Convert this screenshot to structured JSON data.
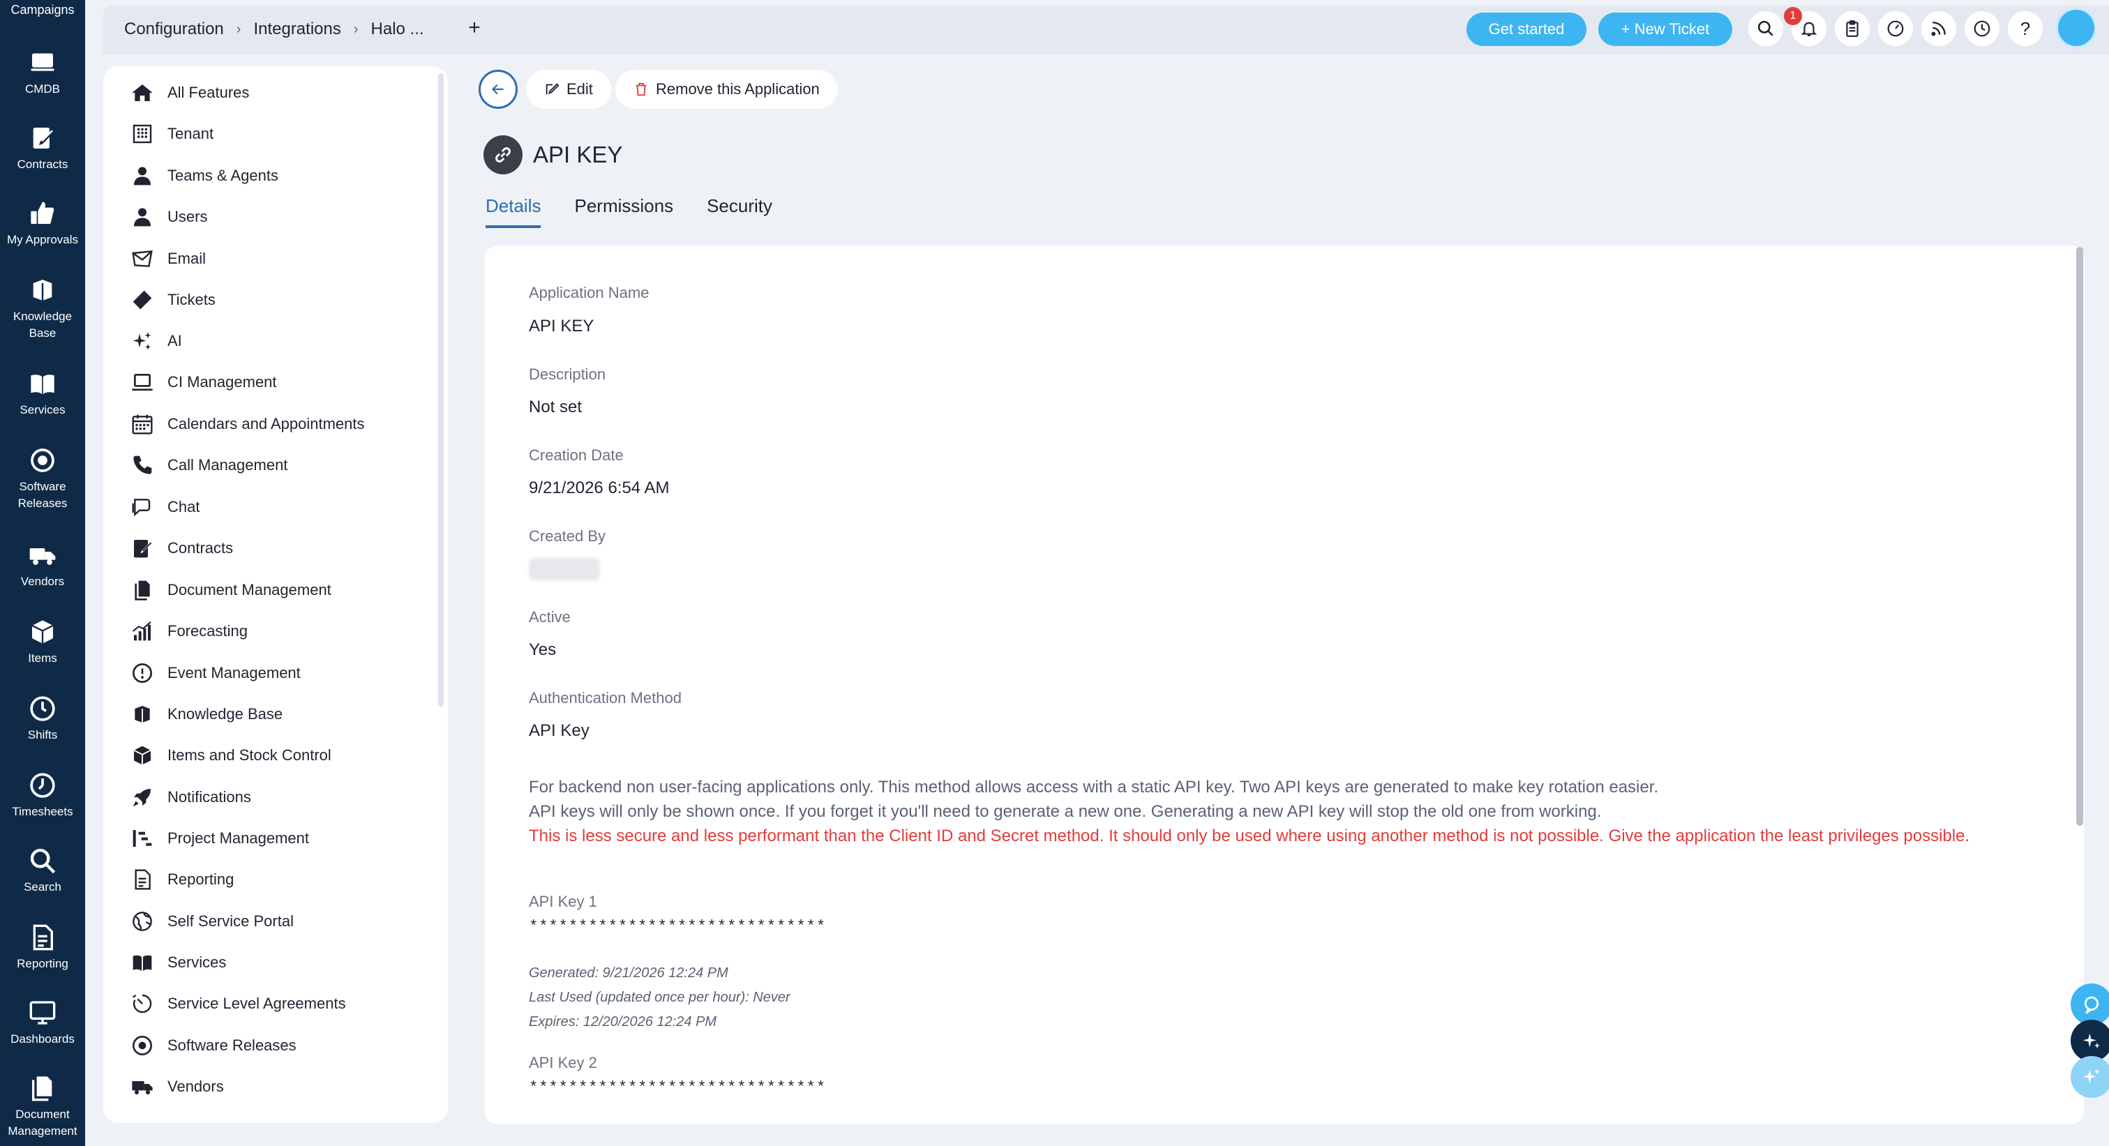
{
  "rail": {
    "top_label": "Campaigns",
    "items": [
      {
        "label": "CMDB",
        "icon": "monitor-icon"
      },
      {
        "label": "Contracts",
        "icon": "contract-edit-icon"
      },
      {
        "label": "My Approvals",
        "icon": "thumbs-up-icon"
      },
      {
        "label": "Knowledge Base",
        "icon": "book-stack-icon"
      },
      {
        "label": "Services",
        "icon": "open-book-icon"
      },
      {
        "label": "Software Releases",
        "icon": "disc-icon"
      },
      {
        "label": "Vendors",
        "icon": "truck-icon"
      },
      {
        "label": "Items",
        "icon": "box-icon"
      },
      {
        "label": "Shifts",
        "icon": "clock-icon"
      },
      {
        "label": "Timesheets",
        "icon": "timer-icon"
      },
      {
        "label": "Search",
        "icon": "search-icon"
      },
      {
        "label": "Reporting",
        "icon": "report-icon"
      },
      {
        "label": "Dashboards",
        "icon": "dashboard-icon"
      },
      {
        "label": "Document Management",
        "icon": "documents-icon"
      }
    ]
  },
  "topbar": {
    "breadcrumbs": [
      "Configuration",
      "Integrations",
      "Halo ..."
    ],
    "add_tab": "+",
    "get_started": "Get started",
    "new_ticket": "+ New Ticket",
    "notification_count": "1",
    "help_glyph": "?"
  },
  "config_menu": [
    {
      "label": "All Features",
      "icon": "home-icon"
    },
    {
      "label": "Tenant",
      "icon": "building-icon"
    },
    {
      "label": "Teams & Agents",
      "icon": "agent-icon"
    },
    {
      "label": "Users",
      "icon": "user-icon"
    },
    {
      "label": "Email",
      "icon": "email-icon"
    },
    {
      "label": "Tickets",
      "icon": "ticket-icon"
    },
    {
      "label": "AI",
      "icon": "sparkle-icon"
    },
    {
      "label": "CI Management",
      "icon": "laptop-icon"
    },
    {
      "label": "Calendars and Appointments",
      "icon": "calendar-icon"
    },
    {
      "label": "Call Management",
      "icon": "phone-icon"
    },
    {
      "label": "Chat",
      "icon": "chat-icon"
    },
    {
      "label": "Contracts",
      "icon": "contract-edit-icon"
    },
    {
      "label": "Document Management",
      "icon": "documents-icon"
    },
    {
      "label": "Forecasting",
      "icon": "chart-bars-icon"
    },
    {
      "label": "Event Management",
      "icon": "alert-circle-icon"
    },
    {
      "label": "Knowledge Base",
      "icon": "book-stack-icon"
    },
    {
      "label": "Items and Stock Control",
      "icon": "box-icon"
    },
    {
      "label": "Notifications",
      "icon": "rocket-icon"
    },
    {
      "label": "Project Management",
      "icon": "project-icon"
    },
    {
      "label": "Reporting",
      "icon": "report-icon"
    },
    {
      "label": "Self Service Portal",
      "icon": "globe-icon"
    },
    {
      "label": "Services",
      "icon": "open-book-icon"
    },
    {
      "label": "Service Level Agreements",
      "icon": "stopwatch-icon"
    },
    {
      "label": "Software Releases",
      "icon": "disc-icon"
    },
    {
      "label": "Vendors",
      "icon": "truck-icon"
    }
  ],
  "actions": {
    "edit": "Edit",
    "remove": "Remove this Application"
  },
  "app": {
    "title": "API KEY",
    "tabs": [
      "Details",
      "Permissions",
      "Security"
    ],
    "active_tab": "Details"
  },
  "details": {
    "app_name_label": "Application Name",
    "app_name_value": "API KEY",
    "description_label": "Description",
    "description_value": "Not set",
    "creation_label": "Creation Date",
    "creation_value": "9/21/2026 6:54 AM",
    "created_by_label": "Created By",
    "active_label": "Active",
    "active_value": "Yes",
    "auth_label": "Authentication Method",
    "auth_value": "API Key",
    "info_line1": "For backend non user-facing applications only. This method allows access with a static API key. Two API keys are generated to make key rotation easier.",
    "info_line2": "API keys will only be shown once. If you forget it you'll need to generate a new one. Generating a new API key will stop the old one from working.",
    "warning": "This is less secure and less performant than the Client ID and Secret method. It should only be used where using another method is not possible. Give the application the least privileges possible.",
    "key1_label": "API Key 1",
    "key1_value": "******************************",
    "key1_generated": "Generated: 9/21/2026 12:24 PM",
    "key1_last_used": "Last Used (updated once per hour): Never",
    "key1_expires": "Expires: 12/20/2026 12:24 PM",
    "key2_label": "API Key 2",
    "key2_value": "******************************"
  },
  "colors": {
    "rail_bg": "#0f2a47",
    "accent": "#3db5f2",
    "link_blue": "#2f6db0",
    "warning_red": "#e23b3b"
  }
}
